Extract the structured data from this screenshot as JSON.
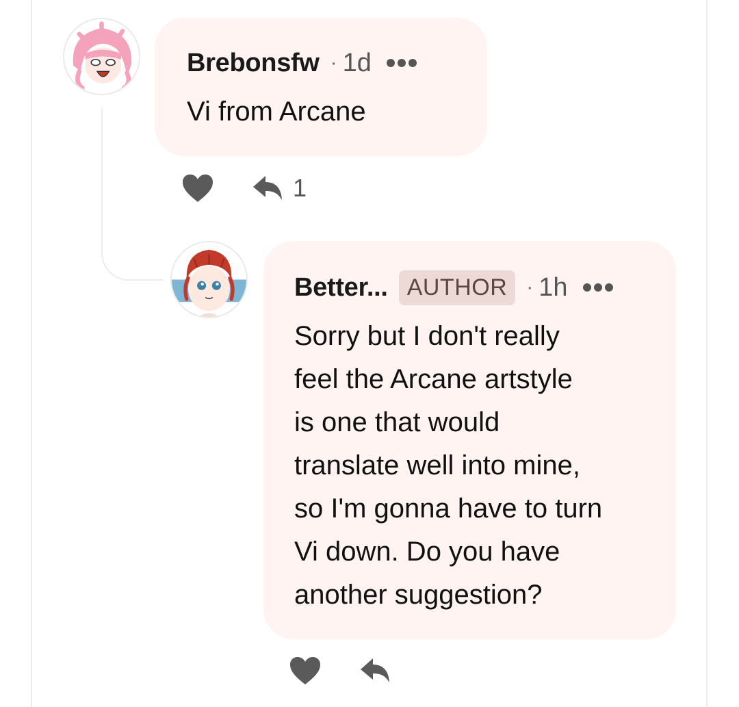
{
  "comments": [
    {
      "username": "Brebonsfw",
      "separator": "·",
      "time": "1d",
      "text": "Vi from Arcane",
      "reply_count": "1",
      "avatar_icon": "pink-hair-anime-avatar-icon"
    },
    {
      "username": "Better...",
      "badge": "AUTHOR",
      "separator": "·",
      "time": "1h",
      "text_lines": [
        "Sorry but I don't really",
        "feel the Arcane artstyle",
        "is one that would",
        "translate well into mine,",
        "so I'm gonna have to turn",
        "Vi down. Do you have",
        "another suggestion?"
      ],
      "avatar_icon": "red-hair-anime-avatar-icon"
    }
  ],
  "icons": {
    "like": "heart-icon",
    "reply": "reply-arrow-icon",
    "more": "more-dots-icon"
  },
  "colors": {
    "bubble": "#fff4f2",
    "badge_bg": "#eddad6",
    "icon": "#555555",
    "text": "#111111"
  }
}
